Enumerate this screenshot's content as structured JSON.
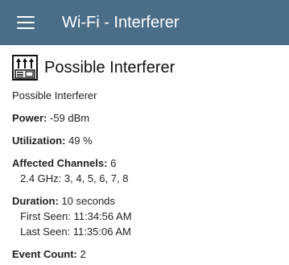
{
  "app_bar": {
    "title": "Wi-Fi - Interferer"
  },
  "detail": {
    "heading": "Possible Interferer",
    "type_text": "Possible Interferer",
    "power": {
      "label": "Power:",
      "value": "-59 dBm"
    },
    "utilization": {
      "label": "Utilization:",
      "value": "49 %"
    },
    "affected_channels": {
      "label": "Affected Channels:",
      "value": "6",
      "band_label": "2.4 GHz:",
      "band_channels": "3, 4, 5, 6, 7, 8"
    },
    "duration": {
      "label": "Duration:",
      "value": "10 seconds",
      "first_seen_label": "First Seen:",
      "first_seen_value": "11:34:56 AM",
      "last_seen_label": "Last Seen:",
      "last_seen_value": "11:35:06 AM"
    },
    "event_count": {
      "label": "Event Count:",
      "value": "2"
    }
  },
  "colors": {
    "app_bar": "#4a6d88",
    "text": "#222222"
  },
  "icons": {
    "menu": "hamburger-menu-icon",
    "device": "interferer-device-icon"
  }
}
